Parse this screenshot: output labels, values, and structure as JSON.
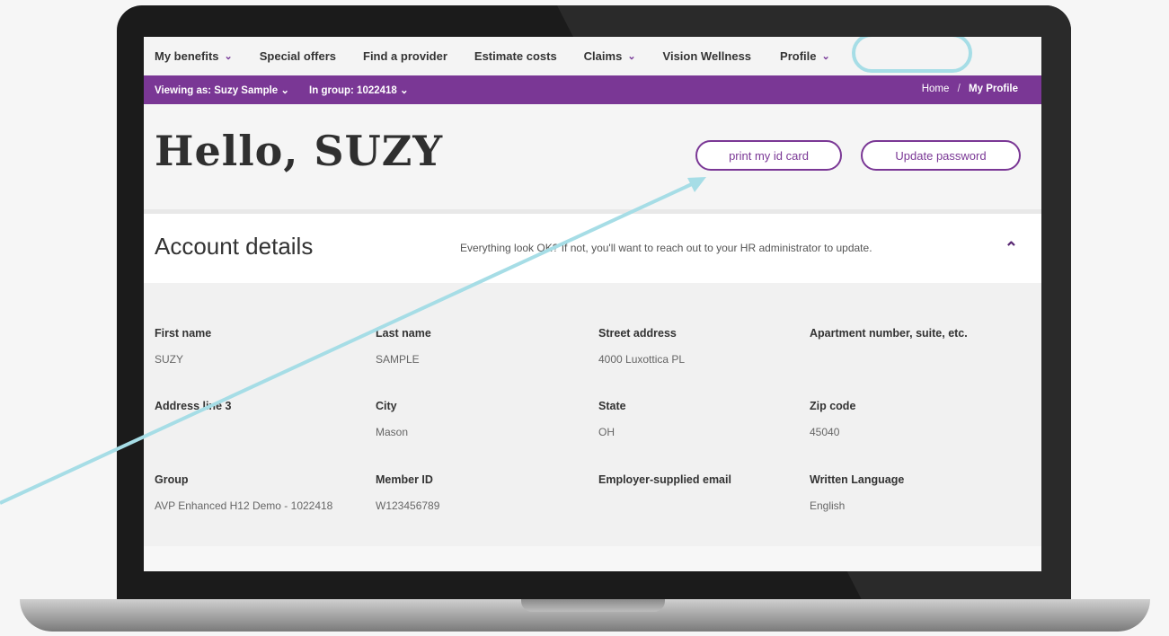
{
  "nav": {
    "items": [
      {
        "label": "My benefits",
        "chevron": true
      },
      {
        "label": "Special offers",
        "chevron": false
      },
      {
        "label": "Find a provider",
        "chevron": false
      },
      {
        "label": "Estimate costs",
        "chevron": false
      },
      {
        "label": "Claims",
        "chevron": true
      },
      {
        "label": "Vision Wellness",
        "chevron": false
      },
      {
        "label": "Profile",
        "chevron": true
      }
    ]
  },
  "bar": {
    "viewing_as": "Viewing as: Suzy Sample",
    "group": "In group: 1022418",
    "breadcrumb_home": "Home",
    "breadcrumb_sep": "/",
    "breadcrumb_current": "My Profile"
  },
  "hero": {
    "greeting": "Hello, SUZY",
    "print_button": "print my id card",
    "password_button": "Update password"
  },
  "account": {
    "title": "Account details",
    "note": "Everything look OK? If not, you'll want to reach out to your HR administrator to update."
  },
  "fields": [
    {
      "label": "First name",
      "value": "SUZY"
    },
    {
      "label": "Last name",
      "value": "SAMPLE"
    },
    {
      "label": "Street address",
      "value": "4000 Luxottica PL"
    },
    {
      "label": "Apartment number, suite, etc.",
      "value": ""
    },
    {
      "label": "Address line 3",
      "value": ""
    },
    {
      "label": "City",
      "value": "Mason"
    },
    {
      "label": "State",
      "value": "OH"
    },
    {
      "label": "Zip code",
      "value": "45040"
    },
    {
      "label": "Group",
      "value": "AVP Enhanced H12 Demo - 1022418"
    },
    {
      "label": "Member ID",
      "value": "W123456789"
    },
    {
      "label": "Employer-supplied email",
      "value": ""
    },
    {
      "label": "Written Language",
      "value": "English"
    }
  ],
  "colors": {
    "purple": "#7a3795",
    "highlight": "#a6dde6"
  },
  "icons": {
    "chevron": "chevron-down-icon",
    "collapse": "chevron-up-icon"
  }
}
